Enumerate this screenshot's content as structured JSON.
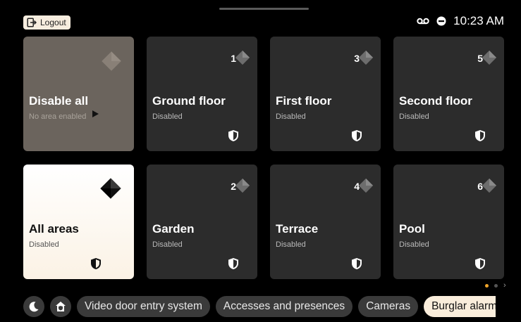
{
  "header": {
    "logout_label": "Logout",
    "time": "10:23 AM",
    "status_icons": [
      "voicemail-icon",
      "do-not-disturb-icon"
    ]
  },
  "tiles": [
    {
      "name": "Disable all",
      "state": "No area enabled",
      "icon": "play-icon"
    },
    {
      "name": "Ground floor",
      "state": "Disabled",
      "number": "1",
      "icon": "shield-icon"
    },
    {
      "name": "First floor",
      "state": "Disabled",
      "number": "3",
      "icon": "shield-icon"
    },
    {
      "name": "Second floor",
      "state": "Disabled",
      "number": "5",
      "icon": "shield-icon"
    },
    {
      "name": "All areas",
      "state": "Disabled",
      "icon": "shield-icon"
    },
    {
      "name": "Garden",
      "state": "Disabled",
      "number": "2",
      "icon": "shield-icon"
    },
    {
      "name": "Terrace",
      "state": "Disabled",
      "number": "4",
      "icon": "shield-icon"
    },
    {
      "name": "Pool",
      "state": "Disabled",
      "number": "6",
      "icon": "shield-icon"
    }
  ],
  "pagination": {
    "current_page": 1,
    "total_pages": 2
  },
  "bottom_nav": {
    "icon_buttons": [
      "moon-icon",
      "home-shield-icon"
    ],
    "chips": [
      {
        "label": "Video door entry system",
        "active": false
      },
      {
        "label": "Accesses and presences",
        "active": false
      },
      {
        "label": "Cameras",
        "active": false
      },
      {
        "label": "Burglar alarm",
        "active": true
      }
    ]
  },
  "colors": {
    "background": "#000000",
    "tile": "#2c2c2c",
    "disable_all_tile": "#6b645d",
    "active_tile": "#fbf2e5",
    "accent": "#f0a52a",
    "active_chip": "#f9eddb"
  }
}
